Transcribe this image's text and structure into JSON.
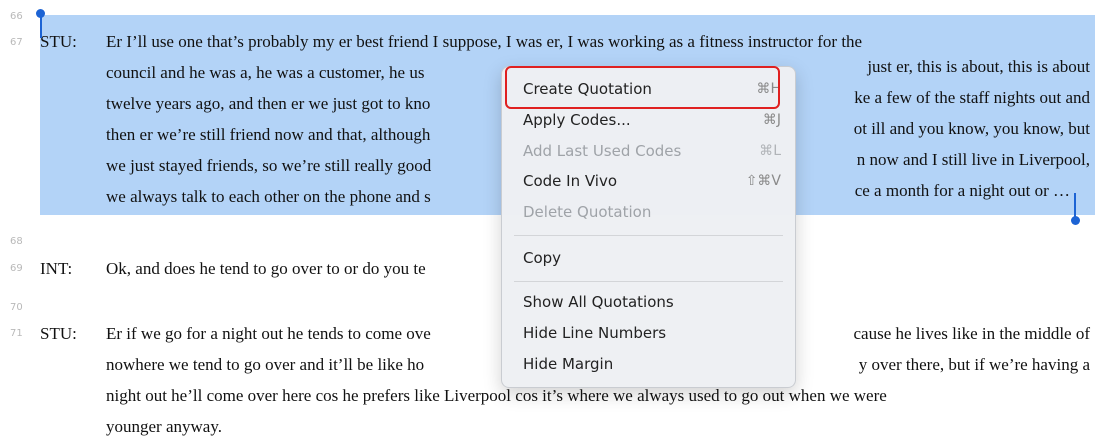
{
  "line_numbers": [
    "66",
    "67",
    "68",
    "69",
    "70",
    "71"
  ],
  "paragraphs": {
    "p1": {
      "speaker": "STU:",
      "lines": [
        "Er I’ll use one that’s probably my er best friend I suppose, I was er, I was working as a fitness instructor for the",
        "council and he was a, he was a customer, he us",
        "twelve years ago, and then er we just got to kno",
        "then er we’re still friend now and that, although",
        "we just stayed friends, so we’re still really good",
        "we always talk to each other on the phone and s"
      ],
      "right_fragments": [
        "just er, this is about, this is about",
        "ke a few of the staff nights out and",
        "ot ill and you know, you know, but",
        "n now and I still live in Liverpool,",
        "ce a month for a night out or …"
      ]
    },
    "p2": {
      "speaker": "INT:",
      "line": "Ok, and does he tend to go over to  or do you te"
    },
    "p3": {
      "speaker": "STU:",
      "lines": [
        "Er if we go for a night out he tends to come ove",
        "nowhere we tend to go over and it’ll be like ho",
        "night out he’ll come over here cos he prefers like Liverpool cos it’s where we always used to go out when we were",
        "younger anyway."
      ],
      "right_fragments": [
        "cause he lives like in the middle of",
        "y over there, but if we’re having a"
      ]
    }
  },
  "context_menu": {
    "items": [
      {
        "label": "Create Quotation",
        "shortcut": "⌘H",
        "enabled": true,
        "highlighted": true
      },
      {
        "label": "Apply Codes...",
        "shortcut": "⌘J",
        "enabled": true
      },
      {
        "label": "Add Last Used Codes",
        "shortcut": "⌘L",
        "enabled": false
      },
      {
        "label": "Code In Vivo",
        "shortcut": "⇧⌘V",
        "enabled": true
      },
      {
        "label": "Delete Quotation",
        "shortcut": "",
        "enabled": false
      },
      {
        "label": "Copy",
        "shortcut": "",
        "enabled": true
      },
      {
        "label": "Show All Quotations",
        "shortcut": "",
        "enabled": true
      },
      {
        "label": "Hide Line Numbers",
        "shortcut": "",
        "enabled": true
      },
      {
        "label": "Hide Margin",
        "shortcut": "",
        "enabled": true
      }
    ]
  },
  "colors": {
    "selection": "#b3d3f7",
    "handle": "#1c63d4",
    "highlight_box": "#e02020"
  }
}
